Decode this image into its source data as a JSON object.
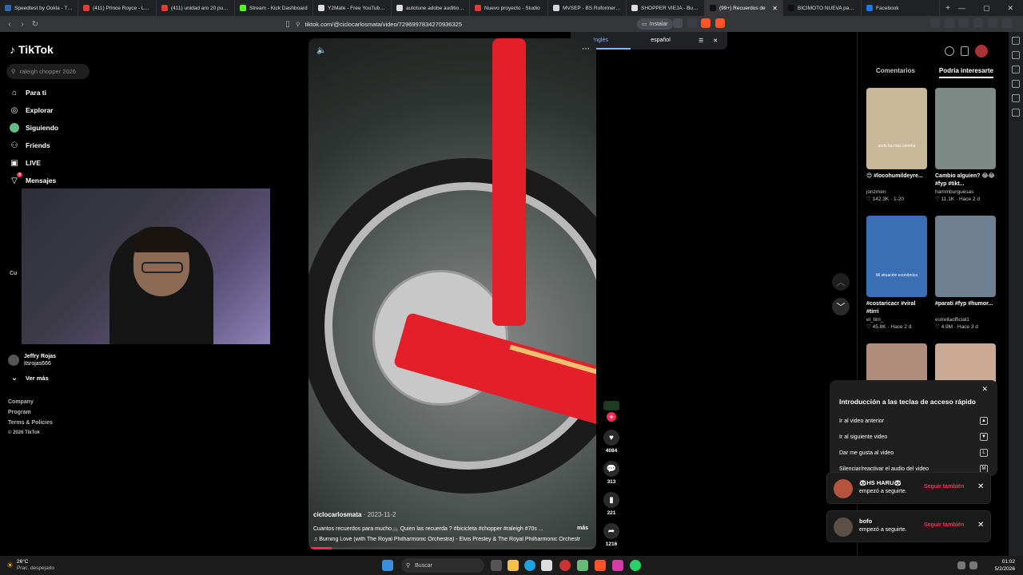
{
  "browser": {
    "tabs": [
      {
        "label": "Speedtest by Ookla - The Gl",
        "color": "#2b6cb0"
      },
      {
        "label": "(411) Prince Royce - La Carr",
        "color": "#e53935"
      },
      {
        "label": "(411) unidad aro 20 pulgada",
        "color": "#e53935"
      },
      {
        "label": "Stream - Kick Dashboard",
        "color": "#53fc18"
      },
      {
        "label": "Y2Mate - Free YouTube to M",
        "color": "#dddddd"
      },
      {
        "label": "autotune adobe audition - B",
        "color": "#dddddd"
      },
      {
        "label": "Nuevo proyecto - Studio",
        "color": "#e53935"
      },
      {
        "label": "MVSEP - BS Roformer SW (",
        "color": "#cfd8dc"
      },
      {
        "label": "SHOPPER VIEJA - Buscar co",
        "color": "#dddddd"
      },
      {
        "label": "(99+) Recuerdos de",
        "color": "#111111",
        "active": true
      },
      {
        "label": "BICIMOTO NUEVA para Bici",
        "color": "#111111"
      },
      {
        "label": "Facebook",
        "color": "#1877f2"
      }
    ],
    "url": "tiktok.com/@ciclocarlosmata/video/7296997834270936325",
    "install_label": "Instalar",
    "notif_count": "1"
  },
  "translate": {
    "from": "Inglés",
    "to": "español"
  },
  "sidebar": {
    "logo": "TikTok",
    "search_placeholder": "raleigh chopper 2026",
    "nav": [
      "Para ti",
      "Explorar",
      "Siguiendo",
      "Friends",
      "LIVE",
      "Mensajes"
    ],
    "messages_badge": "9",
    "section_label": "Cu",
    "account_name": "Jeffry Rojas",
    "account_handle": "itsrojas666",
    "see_more": "Ver más",
    "footer": [
      "Company",
      "Program",
      "Terms & Policies",
      "© 2026 TikTok"
    ]
  },
  "video": {
    "author": "ciclocarlosmata",
    "date": "2023-11-2",
    "caption": "Cuantos recuerdos para mucho🚲 Quien las recuerda ? #bicicleta #chopper #raleigh #70s ...",
    "more": "más",
    "music": "Burning Love (with The Royal Philharmonic Orchestra) - Elvis Presley & The Royal Philharmonic Orchestr",
    "progress": 0.08,
    "likes": "4084",
    "comments": "313",
    "saves": "221",
    "shares": "1216"
  },
  "right_panel": {
    "tab_comments": "Comentarios",
    "tab_suggested": "Podría interesarte",
    "cards": [
      {
        "title": "😊 #locohumildeyre...",
        "author": "jonzmen",
        "likes": "142.3K",
        "date": "1-20",
        "thumb": "#c9b79a"
      },
      {
        "title": "Cambio alguien? 😂😂 #fyp #tikt...",
        "author": "hammburguesas",
        "likes": "11.1K",
        "date": "Hace 2 d",
        "thumb": "#7d8a86"
      },
      {
        "title": "#costaricacr #viral #tirri",
        "author": "el_tirri_",
        "likes": "45.8K",
        "date": "Hace 2 d",
        "thumb": "#3a6fb5"
      },
      {
        "title": "#parati #fyp #humor...",
        "author": "estrellaofficial1",
        "likes": "4.9M",
        "date": "Hace 3 d",
        "thumb": "#6f7f92"
      },
      {
        "title": "",
        "author": "",
        "likes": "",
        "date": "",
        "thumb": "#b08c7a"
      },
      {
        "title": "",
        "author": "",
        "likes": "",
        "date": "",
        "thumb": "#caa995"
      }
    ],
    "thumb_text_1": "ando ba mas comma",
    "thumb_text_3": "Mi situación económica"
  },
  "shortcuts": {
    "title": "Introducción a las teclas de acceso rápido",
    "rows": [
      {
        "label": "Ir al video anterior",
        "key": "▲"
      },
      {
        "label": "Ir al siguiente video",
        "key": "▼"
      },
      {
        "label": "Dar me gusta al video",
        "key": "L"
      },
      {
        "label": "Silenciar/reactivar el audio del video",
        "key": "M"
      }
    ]
  },
  "notifications": [
    {
      "name": "🐼HS HARU🐼",
      "text": "empezó a seguirte.",
      "button": "Seguir también",
      "avatar": "#b5533c"
    },
    {
      "name": "bofo",
      "text": "empezó a seguirte.",
      "button": "Seguir también",
      "avatar": "#5b5045"
    }
  ],
  "taskbar": {
    "temp": "26°C",
    "weather": "Prac. despejado",
    "search": "Buscar",
    "time": "01:02",
    "date": "5/2/2026"
  }
}
